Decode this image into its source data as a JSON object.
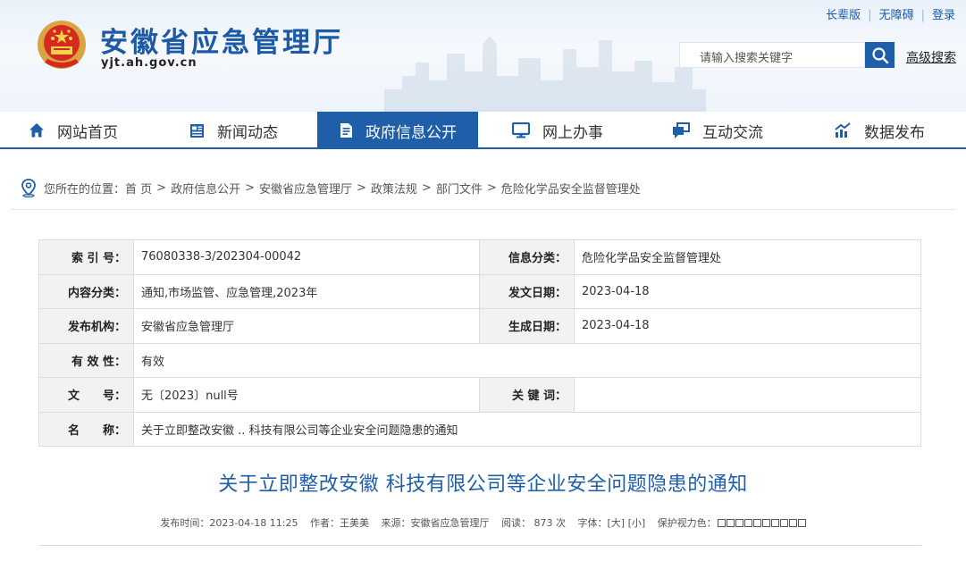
{
  "site": {
    "title": "安徽省应急管理厅",
    "domain": "yjt.ah.gov.cn"
  },
  "toplinks": [
    "长辈版",
    "无障碍",
    "登录"
  ],
  "search": {
    "placeholder": "请输入搜索关键字",
    "advanced_label": "高级搜索"
  },
  "nav": {
    "items": [
      {
        "label": "网站首页",
        "icon": "home-icon",
        "active": false
      },
      {
        "label": "新闻动态",
        "icon": "news-icon",
        "active": false
      },
      {
        "label": "政府信息公开",
        "icon": "document-icon",
        "active": true
      },
      {
        "label": "网上办事",
        "icon": "monitor-icon",
        "active": false
      },
      {
        "label": "互动交流",
        "icon": "chat-icon",
        "active": false
      },
      {
        "label": "数据发布",
        "icon": "chart-icon",
        "active": false
      }
    ]
  },
  "breadcrumb": {
    "prefix": "您所在的位置：",
    "items": [
      "首 页",
      "政府信息公开",
      "安徽省应急管理厅",
      "政策法规",
      "部门文件",
      "危险化学品安全监督管理处"
    ]
  },
  "meta": {
    "index_label": "索 引 号：",
    "index_value": "76080338-3/202304-00042",
    "category_label": "信息分类：",
    "category_value": "危险化学品安全监督管理处",
    "topic_label": "内容分类：",
    "topic_value": "通知,市场监管、应急管理,2023年",
    "issue_date_label": "发文日期：",
    "issue_date_value": "2023-04-18",
    "publisher_label": "发布机构：",
    "publisher_value": "安徽省应急管理厅",
    "created_date_label": "生成日期：",
    "created_date_value": "2023-04-18",
    "validity_label": "有 效 性：",
    "validity_value": "有效",
    "doc_no_label": "文　　号：",
    "doc_no_value": "无〔2023〕null号",
    "keywords_label": "关 键 词：",
    "keywords_value": "",
    "name_label": "名　　称：",
    "name_value": "关于立即整改安徽 .. 科技有限公司等企业安全问题隐患的通知"
  },
  "article": {
    "title": "关于立即整改安徽 科技有限公司等企业安全问题隐患的通知",
    "publish_time": "发布时间：2023-04-18 11:25",
    "author": "作者：王美美",
    "source": "来源：安徽省应急管理厅",
    "reads_label": "阅读：",
    "reads_value": "873",
    "reads_unit": "次",
    "font_label": "字体：",
    "font_large": "[大]",
    "font_small": "[小]",
    "eye_label": "保护视力色：",
    "swatch_count": 10
  }
}
